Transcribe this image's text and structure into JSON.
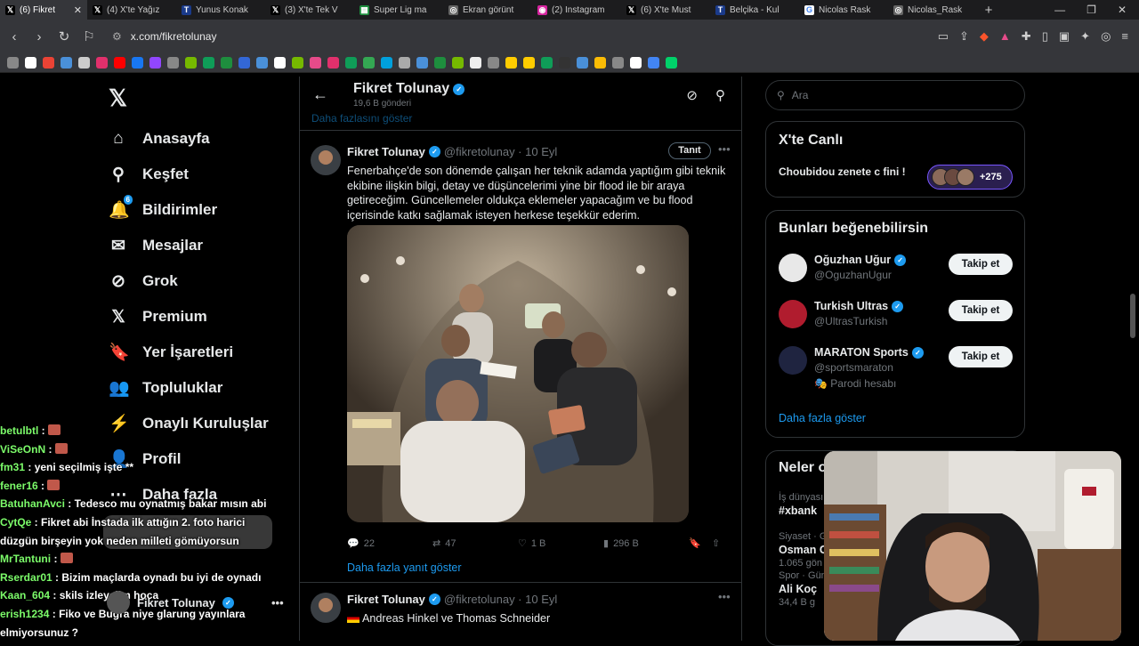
{
  "browser": {
    "tabs": [
      {
        "label": "(6) Fikret",
        "icon": "x-icon",
        "active": true
      },
      {
        "label": "(4) X'te Yağız",
        "icon": "x-icon"
      },
      {
        "label": "Yunus Konak",
        "icon": "tff-icon"
      },
      {
        "label": "(3) X'te Tek V",
        "icon": "x-icon"
      },
      {
        "label": "Super Lig ma",
        "icon": "sheets-icon"
      },
      {
        "label": "Ekran görünt",
        "icon": "globe-icon"
      },
      {
        "label": "(2) Instagram",
        "icon": "instagram-icon"
      },
      {
        "label": "(6) X'te Must",
        "icon": "x-icon"
      },
      {
        "label": "Belçika - Kul",
        "icon": "tff-icon"
      },
      {
        "label": "Nicolas Rask",
        "icon": "google-icon"
      },
      {
        "label": "Nicolas_Rask",
        "icon": "globe-icon"
      }
    ],
    "url": "x.com/fikretolunay"
  },
  "nav": {
    "items": [
      {
        "label": "Anasayfa",
        "icon": "home-icon",
        "glyph": "⌂"
      },
      {
        "label": "Keşfet",
        "icon": "search-icon",
        "glyph": "⚲"
      },
      {
        "label": "Bildirimler",
        "icon": "bell-icon",
        "glyph": "🔔",
        "badge": "6"
      },
      {
        "label": "Mesajlar",
        "icon": "mail-icon",
        "glyph": "✉"
      },
      {
        "label": "Grok",
        "icon": "grok-icon",
        "glyph": "⊘"
      },
      {
        "label": "Premium",
        "icon": "x-icon",
        "glyph": "𝕏"
      },
      {
        "label": "Yer İşaretleri",
        "icon": "bookmark-icon",
        "glyph": "🔖"
      },
      {
        "label": "Topluluklar",
        "icon": "people-icon",
        "glyph": "👥"
      },
      {
        "label": "Onaylı Kuruluşlar",
        "icon": "bolt-icon",
        "glyph": "⚡"
      },
      {
        "label": "Profil",
        "icon": "person-icon",
        "glyph": "👤"
      },
      {
        "label": "Daha fazla",
        "icon": "more-icon",
        "glyph": "⋯"
      }
    ]
  },
  "chat": [
    {
      "user": "betulbtl",
      "msg": ""
    },
    {
      "user": "ViSeOnN",
      "msg": ""
    },
    {
      "user": "fm31",
      "msg": "yeni seçilmiş işte **"
    },
    {
      "user": "fener16",
      "msg": ""
    },
    {
      "user": "BatuhanAvci",
      "msg": "Tedesco mu oynatmış bakar mısın abi"
    },
    {
      "user": "CytQe",
      "msg": "Fikret abi İnstada ilk attığın 2. foto harici düzgün birşeyin yok neden milleti gömüyorsun"
    },
    {
      "user": "MrTantuni",
      "msg": ""
    },
    {
      "user": "Rserdar01",
      "msg": "Bizim maçlarda oynadı bu iyi de oynadı"
    },
    {
      "user": "Kaan_604",
      "msg": "skils izleyelim hoca"
    },
    {
      "user": "erish1234",
      "msg": "Fiko ve Buğra niye glarung yayınlara elmiyorsunuz ?"
    }
  ],
  "account": {
    "name": "Fikret Tolunay"
  },
  "profile": {
    "name": "Fikret Tolunay",
    "posts": "19,6 B gönderi",
    "faded_link": "Daha fazlasını göster"
  },
  "tweet1": {
    "name": "Fikret Tolunay",
    "handle": "@fikretolunay · 10 Eyl",
    "tag": "Tanıt",
    "text": "Fenerbahçe'de son dönemde çalışan her teknik adamda yaptığım gibi teknik ekibine ilişkin bilgi, detay ve düşüncelerimi yine bir flood ile bir araya getireceğim. Güncellemeler oldukça eklemeler yapacağım ve bu flood içerisinde katkı sağlamak isteyen herkese teşekkür ederim.",
    "replies": "22",
    "reposts": "47",
    "likes": "1 B",
    "views": "296 B"
  },
  "show_replies": "Daha fazla yanıt göster",
  "tweet2": {
    "name": "Fikret Tolunay",
    "handle": "@fikretolunay · 10 Eyl",
    "text": "Andreas Hinkel ve Thomas Schneider"
  },
  "right": {
    "search_placeholder": "Ara",
    "live_title": "X'te Canlı",
    "live_text": "Choubidou zenete c fini !",
    "live_count": "+275",
    "suggest_title": "Bunları beğenebilirsin",
    "suggestions": [
      {
        "name": "Oğuzhan Uğur",
        "handle": "@OguzhanUgur",
        "button": "Takip et",
        "color": "#e8e8e8"
      },
      {
        "name": "Turkish Ultras",
        "handle": "@UltrasTurkish",
        "button": "Takip et",
        "color": "#b01c2e"
      },
      {
        "name": "MARATON Sports",
        "handle": "@sportsmaraton",
        "button": "Takip et",
        "color": "#1f2440",
        "parody": "Parodi hesabı"
      }
    ],
    "show_more": "Daha fazla göster",
    "trends_title": "Neler o",
    "trends": [
      {
        "cat": "İş dünyası",
        "name": "#xbank",
        "count": ""
      },
      {
        "cat": "Siyaset · G",
        "name": "Osman G",
        "count": "1.065 gön"
      },
      {
        "cat": "Spor · Gün",
        "name": "Ali Koç",
        "count": "34,4 B g"
      }
    ]
  },
  "colors": {
    "accent": "#1d9bf0",
    "bg": "#000000",
    "border": "#2f3336"
  }
}
